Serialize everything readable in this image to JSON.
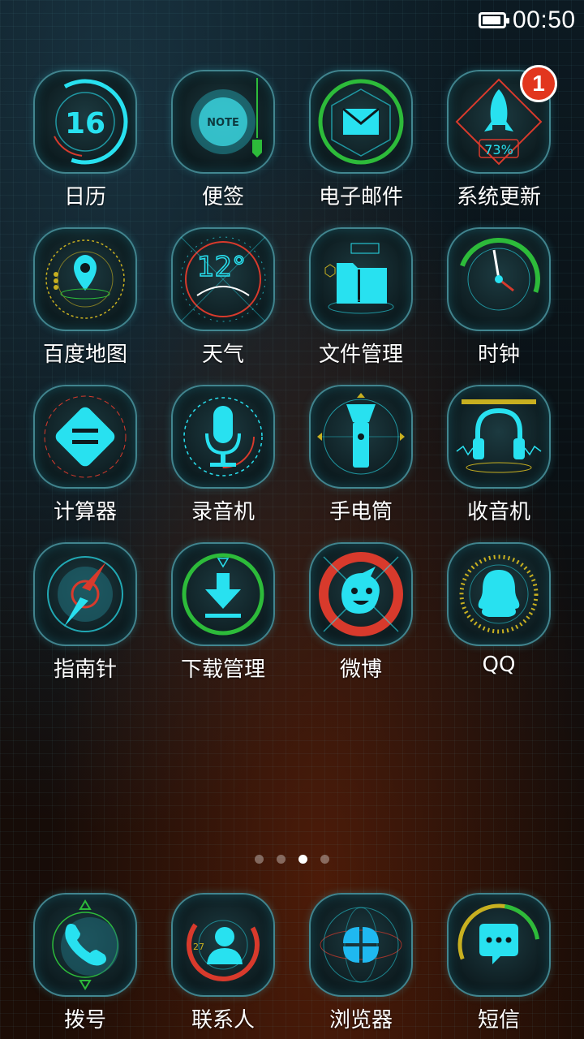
{
  "status": {
    "time": "00:50",
    "battery_level": 0.9
  },
  "apps": [
    {
      "label": "日历",
      "icon": "calendar-icon",
      "day": "16"
    },
    {
      "label": "便签",
      "icon": "note-icon",
      "text": "NOTE"
    },
    {
      "label": "电子邮件",
      "icon": "email-icon"
    },
    {
      "label": "系统更新",
      "icon": "system-update-icon",
      "percent": "73%",
      "badge": "1"
    },
    {
      "label": "百度地图",
      "icon": "baidu-map-icon"
    },
    {
      "label": "天气",
      "icon": "weather-icon",
      "temp": "12°"
    },
    {
      "label": "文件管理",
      "icon": "file-manager-icon"
    },
    {
      "label": "时钟",
      "icon": "clock-icon"
    },
    {
      "label": "计算器",
      "icon": "calculator-icon"
    },
    {
      "label": "录音机",
      "icon": "recorder-icon"
    },
    {
      "label": "手电筒",
      "icon": "flashlight-icon"
    },
    {
      "label": "收音机",
      "icon": "radio-icon"
    },
    {
      "label": "指南针",
      "icon": "compass-icon"
    },
    {
      "label": "下载管理",
      "icon": "download-manager-icon"
    },
    {
      "label": "微博",
      "icon": "weibo-icon"
    },
    {
      "label": "QQ",
      "icon": "qq-icon"
    }
  ],
  "dock": [
    {
      "label": "拨号",
      "icon": "phone-icon"
    },
    {
      "label": "联系人",
      "icon": "contacts-icon",
      "number": "27"
    },
    {
      "label": "浏览器",
      "icon": "browser-icon"
    },
    {
      "label": "短信",
      "icon": "sms-icon"
    }
  ],
  "pager": {
    "pages": 4,
    "current_page": 3
  },
  "colors": {
    "accent_cyan": "#28e1f0",
    "accent_green": "#2dbb3a",
    "accent_red": "#d83a2c",
    "accent_yellow": "#c8b020",
    "badge_red": "#e2361e"
  }
}
